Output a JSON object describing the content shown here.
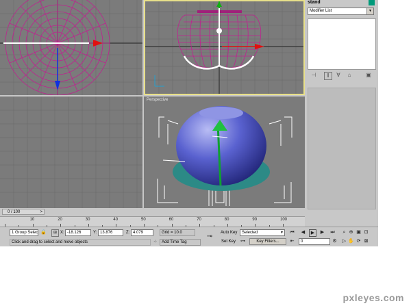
{
  "viewports": {
    "perspective_label": "Perspective"
  },
  "command_panel": {
    "object_name": "stand",
    "object_color": "#009a7a",
    "modifier_list": "Modifier List"
  },
  "timebar": {
    "frame_readout": "0 / 100",
    "arrow": ">"
  },
  "ruler": {
    "labels": [
      "10",
      "20",
      "30",
      "40",
      "50",
      "60",
      "70",
      "80",
      "90",
      "100"
    ]
  },
  "status": {
    "selection": "1 Group Selec",
    "x_label": "X:",
    "x_value": "-18.126",
    "y_label": "Y:",
    "y_value": "13.876",
    "z_label": "Z:",
    "z_value": "4.079",
    "grid": "Grid = 10.0",
    "auto_key": "Auto Key",
    "key_mode": "Selected",
    "set_key": "Set Key",
    "key_filters": "Key Filters...",
    "prompt": "Click and drag to select and move objects",
    "add_time_tag": "Add Time Tag",
    "current_frame": "0"
  },
  "watermark": "pxleyes.com",
  "colors": {
    "viewport_bg": "#7b7b7b",
    "active_border": "#e8e08a",
    "wire": "#c02090",
    "object_blue": "#4f55c8"
  }
}
